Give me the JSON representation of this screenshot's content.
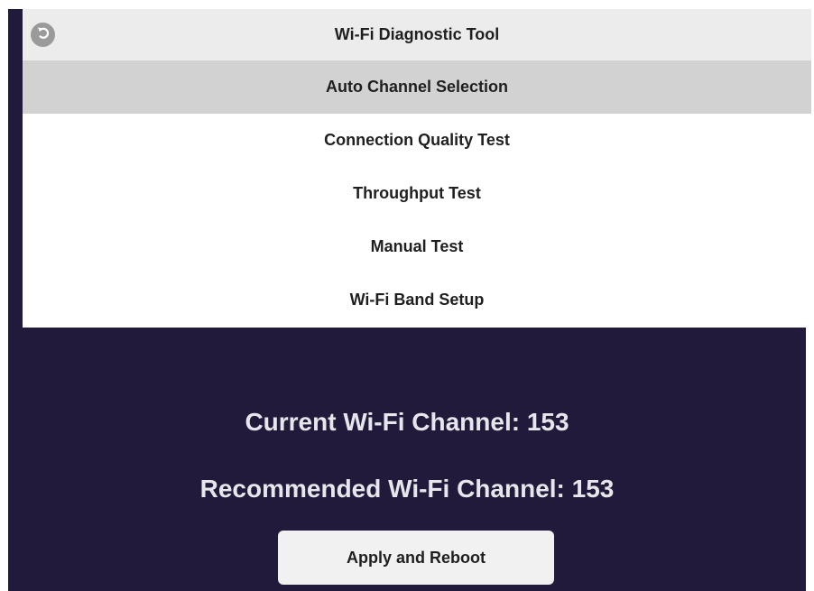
{
  "header": {
    "title": "Wi-Fi Diagnostic Tool",
    "back_icon": "back-arrow-icon"
  },
  "menu": {
    "items": [
      {
        "label": "Auto Channel Selection",
        "active": true
      },
      {
        "label": "Connection Quality Test",
        "active": false
      },
      {
        "label": "Throughput Test",
        "active": false
      },
      {
        "label": "Manual Test",
        "active": false
      },
      {
        "label": "Wi-Fi Band Setup",
        "active": false
      }
    ]
  },
  "channel": {
    "current_label": "Current Wi-Fi Channel: 153",
    "recommended_label": "Recommended Wi-Fi Channel: 153"
  },
  "actions": {
    "apply_label": "Apply and Reboot"
  },
  "colors": {
    "background": "#211a3a",
    "header_bg": "#ececec",
    "active_item_bg": "#d2d2d2",
    "button_bg": "#f1f1f1"
  }
}
